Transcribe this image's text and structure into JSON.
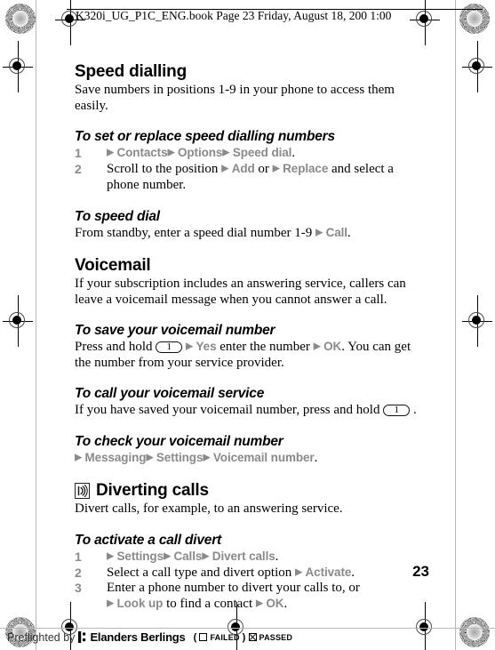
{
  "header": {
    "text": "K320i_UG_P1C_ENG.book  Page 23  Friday, August 18, 200  1:00 "
  },
  "page_number": "23",
  "sections": [
    {
      "title": "Speed dialling",
      "body": "Save numbers in positions 1-9 in your phone to access them easily."
    },
    {
      "title": "Voicemail",
      "body": "If your subscription includes an answering service, callers can leave a voicemail message when you cannot answer a call."
    },
    {
      "title": "Diverting calls",
      "icon": "call-divert-icon",
      "body": "Divert calls, for example, to an answering service."
    }
  ],
  "procedures": {
    "set_speed_dial": {
      "heading": "To set or replace speed dialling numbers",
      "steps": [
        {
          "num": "1",
          "parts": [
            {
              "type": "arrow",
              "text": "▶"
            },
            {
              "type": "menu",
              "text": "Contacts"
            },
            {
              "type": "arrow",
              "text": "▶"
            },
            {
              "type": "menu",
              "text": "Options"
            },
            {
              "type": "arrow",
              "text": "▶"
            },
            {
              "type": "menu",
              "text": "Speed dial"
            },
            {
              "type": "plain",
              "text": "."
            }
          ]
        },
        {
          "num": "2",
          "parts": [
            {
              "type": "plain",
              "text": "Scroll to the position "
            },
            {
              "type": "arrow",
              "text": "▶"
            },
            {
              "type": "menu",
              "text": "Add"
            },
            {
              "type": "plain",
              "text": " or "
            },
            {
              "type": "arrow",
              "text": "▶"
            },
            {
              "type": "menu",
              "text": "Replace"
            },
            {
              "type": "plain",
              "text": " and select a phone number."
            }
          ]
        }
      ]
    },
    "speed_dial": {
      "heading": "To speed dial",
      "line": [
        {
          "type": "plain",
          "text": "From standby, enter a speed dial number 1-9 "
        },
        {
          "type": "arrow",
          "text": "▶"
        },
        {
          "type": "menu",
          "text": "Call"
        },
        {
          "type": "plain",
          "text": "."
        }
      ]
    },
    "save_voicemail": {
      "heading": "To save your voicemail number",
      "line": [
        {
          "type": "plain",
          "text": "Press and hold "
        },
        {
          "type": "key",
          "text": "1"
        },
        {
          "type": "arrow",
          "text": "▶"
        },
        {
          "type": "menu",
          "text": "Yes"
        },
        {
          "type": "plain",
          "text": " enter the number "
        },
        {
          "type": "arrow",
          "text": "▶"
        },
        {
          "type": "menu",
          "text": "OK"
        },
        {
          "type": "plain",
          "text": ". You can get the number from your service provider."
        }
      ]
    },
    "call_voicemail": {
      "heading": "To call your voicemail service",
      "line": [
        {
          "type": "plain",
          "text": "If you have saved your voicemail number, press and hold "
        },
        {
          "type": "key",
          "text": "1"
        },
        {
          "type": "plain",
          "text": "."
        }
      ]
    },
    "check_voicemail": {
      "heading": "To check your voicemail number",
      "line": [
        {
          "type": "arrow",
          "text": "▶"
        },
        {
          "type": "menu",
          "text": "Messaging"
        },
        {
          "type": "arrow",
          "text": "▶"
        },
        {
          "type": "menu",
          "text": "Settings"
        },
        {
          "type": "arrow",
          "text": "▶"
        },
        {
          "type": "menu",
          "text": "Voicemail number"
        },
        {
          "type": "plain",
          "text": "."
        }
      ]
    },
    "activate_divert": {
      "heading": "To activate a call divert",
      "steps": [
        {
          "num": "1",
          "parts": [
            {
              "type": "arrow",
              "text": "▶"
            },
            {
              "type": "menu",
              "text": "Settings"
            },
            {
              "type": "arrow",
              "text": "▶"
            },
            {
              "type": "menu",
              "text": "Calls"
            },
            {
              "type": "arrow",
              "text": "▶"
            },
            {
              "type": "menu",
              "text": "Divert calls"
            },
            {
              "type": "plain",
              "text": "."
            }
          ]
        },
        {
          "num": "2",
          "parts": [
            {
              "type": "plain",
              "text": "Select a call type and divert option "
            },
            {
              "type": "arrow",
              "text": "▶"
            },
            {
              "type": "menu",
              "text": "Activate"
            },
            {
              "type": "plain",
              "text": "."
            }
          ]
        },
        {
          "num": "3",
          "parts": [
            {
              "type": "plain",
              "text": "Enter a phone number to divert your calls to, or"
            },
            {
              "type": "break"
            },
            {
              "type": "arrow",
              "text": "▶"
            },
            {
              "type": "menu",
              "text": "Look up"
            },
            {
              "type": "plain",
              "text": " to find a contact "
            },
            {
              "type": "arrow",
              "text": "▶"
            },
            {
              "type": "menu",
              "text": "OK"
            },
            {
              "type": "plain",
              "text": "."
            }
          ]
        }
      ]
    }
  },
  "footer": {
    "preflight_text": "Preflighted by",
    "brand": "Elanders Berlings",
    "open_paren": "(",
    "failed_label": "FAILED",
    "close_paren": ")",
    "passed_label": "PASSED"
  },
  "colors": {
    "menu_gray": "#8a8a8a",
    "text_black": "#000000",
    "paper": "#ffffff"
  }
}
